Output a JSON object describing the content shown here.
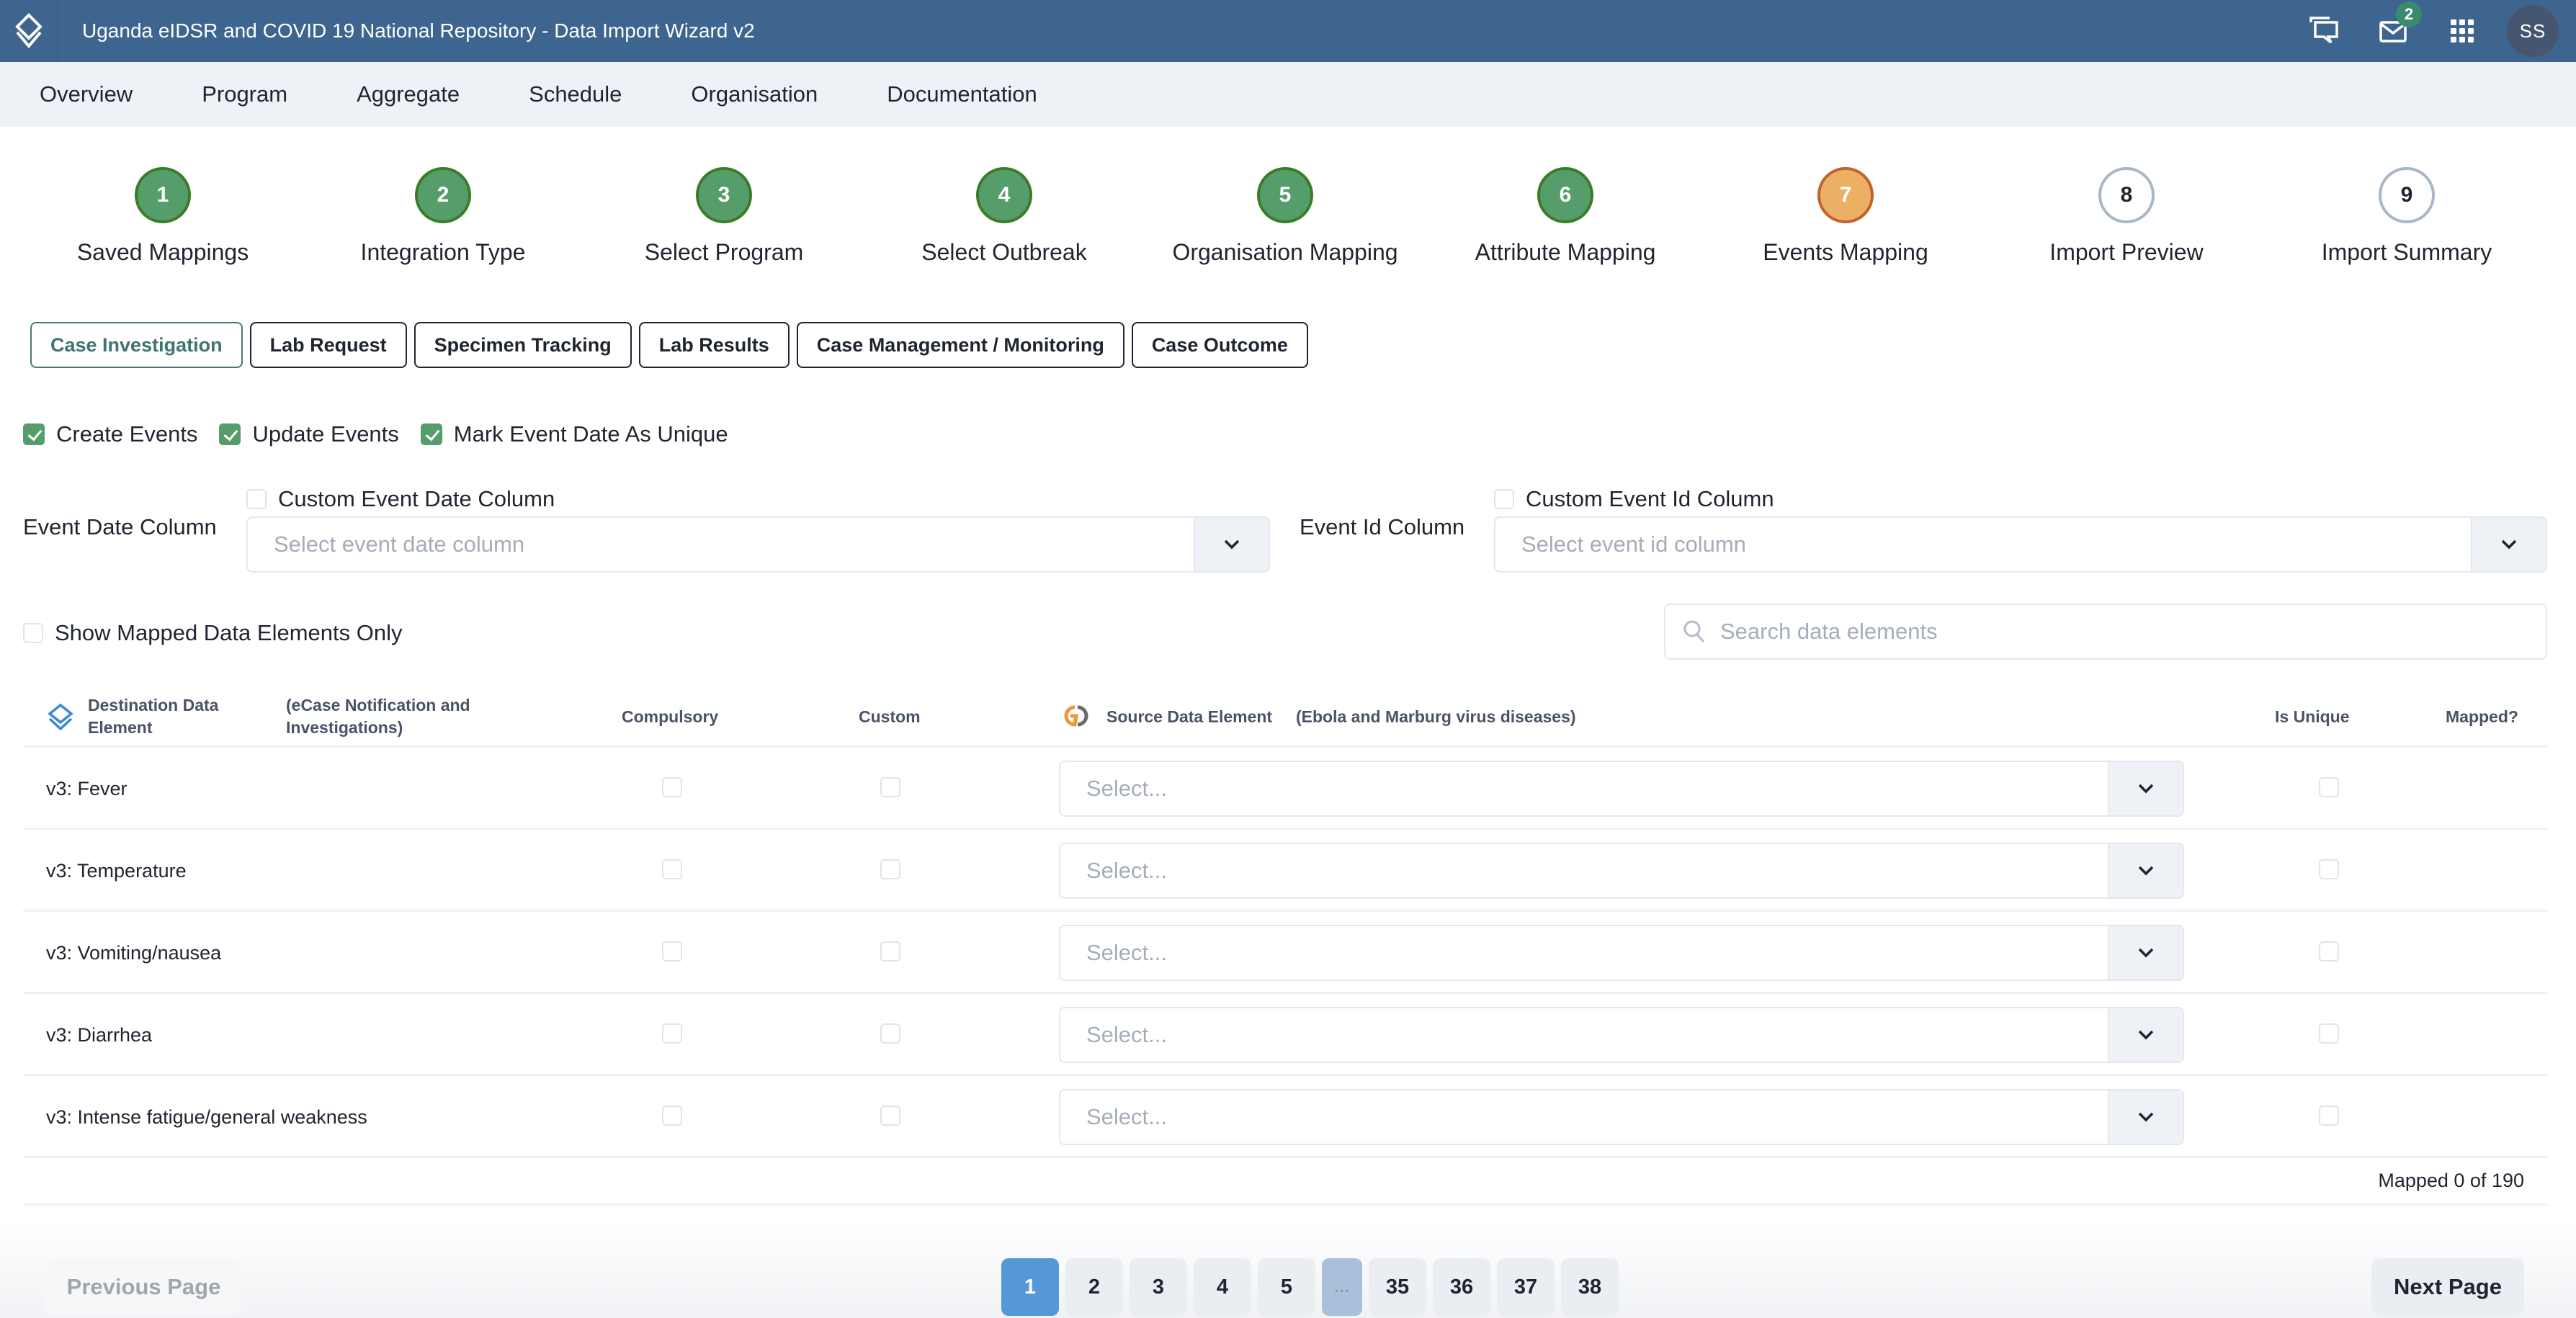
{
  "header": {
    "title": "Uganda eIDSR and COVID 19 National Repository - Data Import Wizard v2",
    "icons": [
      "app-logo-icon",
      "chat-icon",
      "mail-icon",
      "apps-grid-icon"
    ],
    "mail_badge": "2",
    "avatar_initials": "SS",
    "colors": {
      "bar": "#3d6590",
      "badge": "#3c8a6e",
      "avatar": "#465570"
    }
  },
  "nav": {
    "items": [
      "Overview",
      "Program",
      "Aggregate",
      "Schedule",
      "Organisation",
      "Documentation"
    ]
  },
  "stepper": {
    "steps": [
      {
        "number": "1",
        "label": "Saved Mappings",
        "status": "done"
      },
      {
        "number": "2",
        "label": "Integration Type",
        "status": "done"
      },
      {
        "number": "3",
        "label": "Select Program",
        "status": "done"
      },
      {
        "number": "4",
        "label": "Select Outbreak",
        "status": "done"
      },
      {
        "number": "5",
        "label": "Organisation Mapping",
        "status": "done"
      },
      {
        "number": "6",
        "label": "Attribute Mapping",
        "status": "done"
      },
      {
        "number": "7",
        "label": "Events Mapping",
        "status": "active"
      },
      {
        "number": "8",
        "label": "Import Preview",
        "status": "todo"
      },
      {
        "number": "9",
        "label": "Import Summary",
        "status": "todo"
      }
    ],
    "colors": {
      "done": "#569d6c",
      "active": "#ebb064",
      "todo": "#ffffff"
    }
  },
  "stage_tabs": {
    "items": [
      "Case Investigation",
      "Lab Request",
      "Specimen Tracking",
      "Lab Results",
      "Case Management / Monitoring",
      "Case Outcome"
    ],
    "active": "Case Investigation"
  },
  "options": {
    "create_events": {
      "label": "Create Events",
      "checked": true
    },
    "update_events": {
      "label": "Update Events",
      "checked": true
    },
    "mark_unique": {
      "label": "Mark Event Date As Unique",
      "checked": true
    }
  },
  "event_date": {
    "label": "Event Date Column",
    "custom_label": "Custom Event Date Column",
    "custom_checked": false,
    "placeholder": "Select event date column"
  },
  "event_id": {
    "label": "Event Id Column",
    "custom_label": "Custom Event Id Column",
    "custom_checked": false,
    "placeholder": "Select event id column"
  },
  "filter": {
    "show_mapped_label": "Show Mapped Data Elements Only",
    "show_mapped_checked": false,
    "search_placeholder": "Search data elements",
    "search_value": ""
  },
  "table": {
    "headers": {
      "destination": "Destination Data Element",
      "destination_program": "(eCase Notification and Investigations)",
      "compulsory": "Compulsory",
      "custom": "Custom",
      "source": "Source Data Element",
      "source_program": "(Ebola and Marburg virus diseases)",
      "is_unique": "Is Unique",
      "mapped": "Mapped?"
    },
    "rows": [
      {
        "name": "v3: Fever",
        "compulsory": false,
        "custom": false,
        "source_placeholder": "Select...",
        "is_unique": false
      },
      {
        "name": "v3: Temperature",
        "compulsory": false,
        "custom": false,
        "source_placeholder": "Select...",
        "is_unique": false
      },
      {
        "name": "v3: Vomiting/nausea",
        "compulsory": false,
        "custom": false,
        "source_placeholder": "Select...",
        "is_unique": false
      },
      {
        "name": "v3: Diarrhea",
        "compulsory": false,
        "custom": false,
        "source_placeholder": "Select...",
        "is_unique": false
      },
      {
        "name": "v3: Intense fatigue/general weakness",
        "compulsory": false,
        "custom": false,
        "source_placeholder": "Select...",
        "is_unique": false
      }
    ],
    "mapped_summary": "Mapped 0 of 190"
  },
  "pagination": {
    "previous_label": "Previous Page",
    "next_label": "Next Page",
    "pages": [
      "1",
      "2",
      "3",
      "4",
      "5",
      "...",
      "35",
      "36",
      "37",
      "38"
    ],
    "current": "1",
    "colors": {
      "current": "#5598d7"
    }
  }
}
